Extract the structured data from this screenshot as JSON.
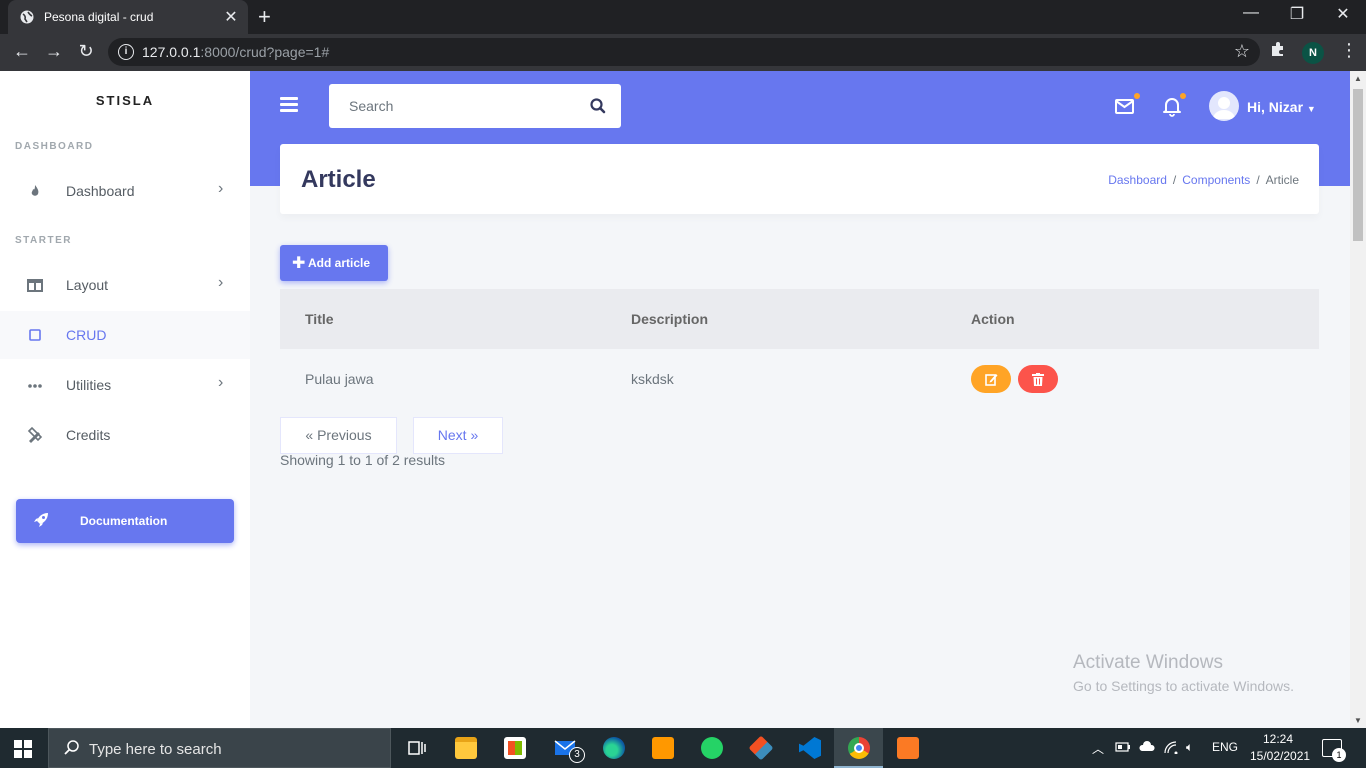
{
  "browser": {
    "tab_title": "Pesona digital - crud",
    "url_host": "127.0.0.1",
    "url_rest": ":8000/crud?page=1#",
    "profile_initial": "N"
  },
  "sidebar": {
    "brand": "STISLA",
    "header_dashboard": "DASHBOARD",
    "header_starter": "STARTER",
    "items": [
      {
        "label": "Dashboard",
        "icon": "fire-icon"
      },
      {
        "label": "Layout",
        "icon": "columns-icon"
      },
      {
        "label": "CRUD",
        "icon": "square-icon"
      },
      {
        "label": "Utilities",
        "icon": "ellipsis-icon"
      },
      {
        "label": "Credits",
        "icon": "pencil-ruler-icon"
      }
    ],
    "doc_button": "Documentation"
  },
  "navbar": {
    "search_placeholder": "Search",
    "user_greeting": "Hi, Nizar"
  },
  "section": {
    "title": "Article",
    "breadcrumb": [
      "Dashboard",
      "Components",
      "Article"
    ]
  },
  "content": {
    "add_button": "Add article",
    "columns": [
      "Title",
      "Description",
      "Action"
    ],
    "rows": [
      {
        "title": "Pulau jawa",
        "description": "kskdsk"
      }
    ],
    "prev": "« Previous",
    "next": "Next »",
    "showing": "Showing 1 to 1 of 2 results"
  },
  "watermark": {
    "line1": "Activate Windows",
    "line2": "Go to Settings to activate Windows."
  },
  "taskbar": {
    "search_text": "Type here to search",
    "mail_badge": "3",
    "language": "ENG",
    "time": "12:24",
    "date": "15/02/2021",
    "notif_count": "1"
  },
  "colors": {
    "primary": "#6777ef",
    "warning": "#ffa426",
    "danger": "#fc544b"
  }
}
